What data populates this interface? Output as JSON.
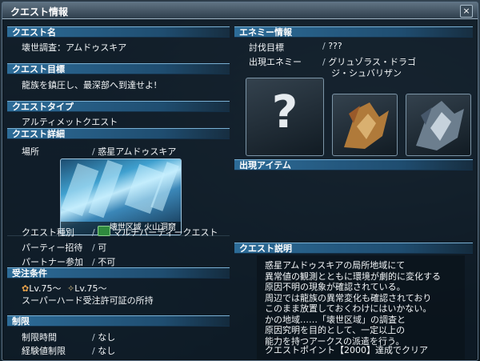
{
  "window": {
    "title": "クエスト情報",
    "close_label": "×"
  },
  "left": {
    "quest_name": {
      "header": "クエスト名",
      "value": "壊世調査：アムドゥスキア"
    },
    "quest_goal": {
      "header": "クエスト目標",
      "value": "龍族を鎮圧し、最深部へ到達せよ!"
    },
    "quest_type": {
      "header": "クエストタイプ",
      "value": "アルティメットクエスト"
    },
    "quest_detail": {
      "header": "クエスト詳細",
      "location_label": "場所",
      "location_value": "惑星アムドゥスキア",
      "image_caption": "壊世区域 火山洞窟",
      "rows": [
        {
          "label": "クエスト種別",
          "value": "マルチパーティークエスト",
          "icon": "multi-party-icon"
        },
        {
          "label": "パーティー招待",
          "value": "可"
        },
        {
          "label": "パートナー参加",
          "value": "不可"
        }
      ]
    },
    "conditions": {
      "header": "受注条件",
      "level_1": "Lv.75～",
      "level_2": "Lv.75～",
      "requirement": "スーパーハード受注許可証の所持"
    },
    "limits": {
      "header": "制限",
      "rows": [
        {
          "label": "制限時間",
          "value": "なし"
        },
        {
          "label": "経験値制限",
          "value": "なし"
        }
      ]
    }
  },
  "right": {
    "enemy": {
      "header": "エネミー情報",
      "target_label": "討伐目標",
      "target_value": "???",
      "appear_label": "出現エネミー",
      "appear_value_1": "グリュゾラス・ドラゴ",
      "appear_value_2": "ジ・シュバリザン",
      "unknown_mark": "?"
    },
    "items": {
      "header": "出現アイテム"
    },
    "description": {
      "header": "クエスト説明",
      "lines": [
        "惑星アムドゥスキアの局所地域にて",
        "異常値の観測とともに環境が劇的に変化する",
        "原因不明の現象が確認されている。",
        "周辺では龍族の異常変化も確認されており",
        "このまま放置しておくわけにはいかない。",
        "かの地域……「壊世区域」の調査と",
        "原因究明を目的として、一定以上の",
        "能力を持つアークスの派遣を行う。"
      ],
      "points": "クエストポイント【2000】達成でクリア"
    }
  }
}
